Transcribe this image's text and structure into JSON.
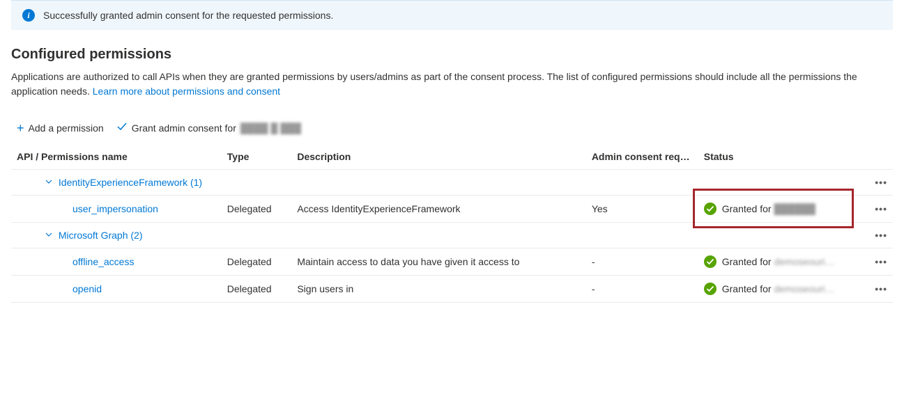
{
  "notification": {
    "message": "Successfully granted admin consent for the requested permissions."
  },
  "section": {
    "heading": "Configured permissions",
    "description_prefix": "Applications are authorized to call APIs when they are granted permissions by users/admins as part of the consent process. The list of configured permissions should include all the permissions the application needs. ",
    "learn_more": "Learn more about permissions and consent"
  },
  "toolbar": {
    "add_permission": "Add a permission",
    "grant_consent_prefix": "Grant admin consent for ",
    "tenant_blurred": "████ █ ███"
  },
  "table": {
    "headers": {
      "name": "API / Permissions name",
      "type": "Type",
      "description": "Description",
      "consent": "Admin consent req…",
      "status": "Status"
    },
    "groups": [
      {
        "label": "IdentityExperienceFramework (1)",
        "permissions": [
          {
            "name": "user_impersonation",
            "type": "Delegated",
            "description": "Access IdentityExperienceFramework",
            "consent": "Yes",
            "status_prefix": "Granted for ",
            "status_blurred": "██████",
            "highlighted": true
          }
        ]
      },
      {
        "label": "Microsoft Graph (2)",
        "permissions": [
          {
            "name": "offline_access",
            "type": "Delegated",
            "description": "Maintain access to data you have given it access to",
            "consent": "-",
            "status_prefix": "Granted for ",
            "status_blurred": "demoseouri…",
            "highlighted": false
          },
          {
            "name": "openid",
            "type": "Delegated",
            "description": "Sign users in",
            "consent": "-",
            "status_prefix": "Granted for ",
            "status_blurred": "demoseouri…",
            "highlighted": false
          }
        ]
      }
    ]
  }
}
